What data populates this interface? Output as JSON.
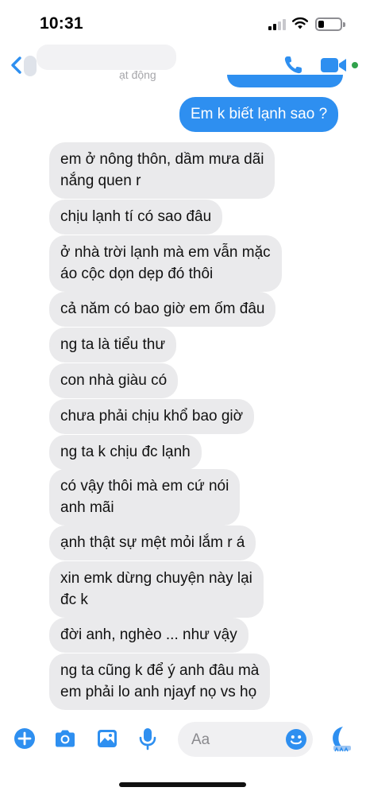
{
  "status_bar": {
    "time": "10:31",
    "signal_bars": 2,
    "signal_total": 4,
    "battery_level": 0.25
  },
  "header": {
    "subtitle": "ạt động",
    "accent_color": "#2e8ff0",
    "online_color": "#31a24c",
    "icons": [
      "back-arrow-icon",
      "phone-icon",
      "video-camera-icon"
    ]
  },
  "messages": [
    {
      "sender": "me",
      "lines": [
        "Em k biết lạnh sao ?"
      ]
    },
    {
      "sender": "them",
      "lines": [
        "em ở nông thôn, dầm mưa dãi",
        "nắng quen r"
      ]
    },
    {
      "sender": "them",
      "lines": [
        "chịu lạnh tí có sao đâu"
      ]
    },
    {
      "sender": "them",
      "lines": [
        "ở nhà trời lạnh mà em vẫn mặc",
        "áo cộc dọn dẹp đó thôi"
      ]
    },
    {
      "sender": "them",
      "lines": [
        "cả năm có bao giờ em ốm đâu"
      ]
    },
    {
      "sender": "them",
      "lines": [
        "ng ta là tiểu thư"
      ]
    },
    {
      "sender": "them",
      "lines": [
        "con nhà giàu có"
      ]
    },
    {
      "sender": "them",
      "lines": [
        "chưa phải chịu khổ bao giờ"
      ]
    },
    {
      "sender": "them",
      "lines": [
        "ng ta k chịu đc lạnh"
      ]
    },
    {
      "sender": "them",
      "lines": [
        "có vậy thôi mà em cứ nói",
        "anh mãi"
      ]
    },
    {
      "sender": "them",
      "lines": [
        "ạnh thật sự mệt mỏi lắm r á"
      ]
    },
    {
      "sender": "them",
      "lines": [
        "xin emk dừng chuyện này lại",
        "đc k"
      ]
    },
    {
      "sender": "them",
      "lines": [
        "đời anh, nghèo ... như vậy"
      ]
    },
    {
      "sender": "them",
      "lines": [
        "ng ta cũng k để ý anh đâu mà",
        "em phải lo anh njayf nọ vs họ"
      ]
    }
  ],
  "composer": {
    "placeholder": "Aa",
    "icons": [
      "plus-icon",
      "camera-icon",
      "image-icon",
      "microphone-icon",
      "emoji-icon",
      "like-icon"
    ]
  }
}
